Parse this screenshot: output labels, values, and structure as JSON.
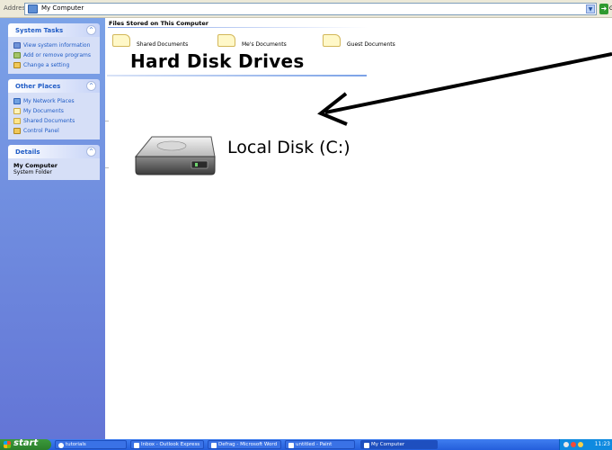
{
  "address_bar": {
    "label": "Address",
    "value": "My Computer",
    "go_label": "Go"
  },
  "left_panel": {
    "system_tasks": {
      "title": "System Tasks",
      "items": [
        "View system information",
        "Add or remove programs",
        "Change a setting"
      ]
    },
    "other_places": {
      "title": "Other Places",
      "items": [
        "My Network Places",
        "My Documents",
        "Shared Documents",
        "Control Panel"
      ]
    },
    "details": {
      "title": "Details",
      "name": "My Computer",
      "type": "System Folder"
    }
  },
  "main": {
    "files_section_title": "Files Stored on This Computer",
    "folders": [
      "Shared Documents",
      "Me's Documents",
      "Guest Documents"
    ],
    "drives_section_title": "Hard Disk Drives",
    "drives": [
      "Local Disk (C:)"
    ]
  },
  "taskbar": {
    "start_label": "start",
    "buttons": [
      {
        "label": "tutorials",
        "active": false
      },
      {
        "label": "Inbox - Outlook Express",
        "active": false
      },
      {
        "label": "Defrag - Microsoft Word",
        "active": false
      },
      {
        "label": "untitled - Paint",
        "active": false
      },
      {
        "label": "My Computer",
        "active": true
      }
    ],
    "clock": "11:23"
  },
  "colors": {
    "panel_gradient_top": "#7ba2e7",
    "panel_gradient_bottom": "#6375d6",
    "link_blue": "#215dc6",
    "taskbar_blue": "#245edb",
    "start_green": "#2b7f2b"
  }
}
